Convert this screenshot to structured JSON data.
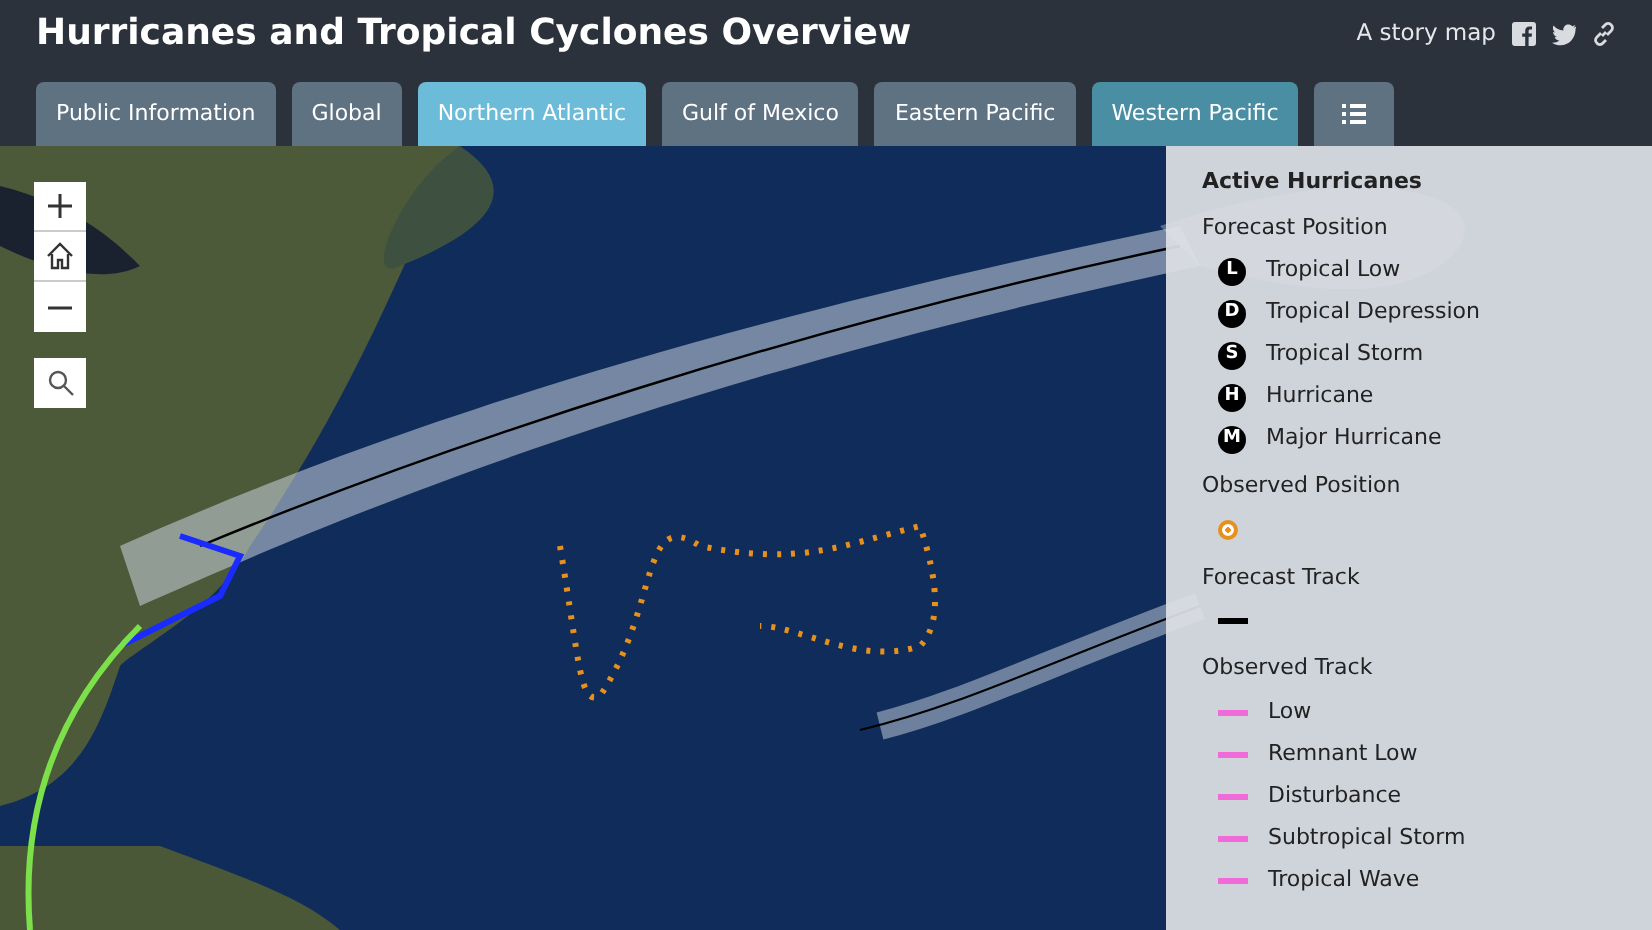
{
  "header": {
    "title": "Hurricanes and Tropical Cyclones Overview",
    "tagline": "A story map"
  },
  "tabs": [
    {
      "label": "Public Information",
      "selected": false,
      "hovered": false,
      "kind": "text"
    },
    {
      "label": "Global",
      "selected": false,
      "hovered": false,
      "kind": "text"
    },
    {
      "label": "Northern Atlantic",
      "selected": true,
      "hovered": false,
      "kind": "text"
    },
    {
      "label": "Gulf of Mexico",
      "selected": false,
      "hovered": false,
      "kind": "text"
    },
    {
      "label": "Eastern Pacific",
      "selected": false,
      "hovered": false,
      "kind": "text"
    },
    {
      "label": "Western Pacific",
      "selected": false,
      "hovered": true,
      "kind": "text"
    },
    {
      "selected": false,
      "hovered": false,
      "kind": "list"
    }
  ],
  "legend": {
    "title": "Active Hurricanes",
    "sections": [
      {
        "heading": "Forecast Position",
        "items": [
          {
            "kind": "symbol",
            "symbol": "L",
            "label": "Tropical Low"
          },
          {
            "kind": "symbol",
            "symbol": "D",
            "label": "Tropical Depression"
          },
          {
            "kind": "symbol",
            "symbol": "S",
            "label": "Tropical Storm"
          },
          {
            "kind": "symbol",
            "symbol": "H",
            "label": "Hurricane"
          },
          {
            "kind": "symbol",
            "symbol": "M",
            "label": "Major Hurricane"
          }
        ]
      },
      {
        "heading": "Observed Position",
        "items": [
          {
            "kind": "dot",
            "color": "#e8901c"
          }
        ]
      },
      {
        "heading": "Forecast Track",
        "items": [
          {
            "kind": "line",
            "color": "#000000"
          }
        ]
      },
      {
        "heading": "Observed Track",
        "items": [
          {
            "kind": "line",
            "color": "#f06ad8",
            "label": "Low"
          },
          {
            "kind": "line",
            "color": "#f06ad8",
            "label": "Remnant Low"
          },
          {
            "kind": "line",
            "color": "#f06ad8",
            "label": "Disturbance"
          },
          {
            "kind": "line",
            "color": "#f06ad8",
            "label": "Subtropical Storm"
          },
          {
            "kind": "line",
            "color": "#f06ad8",
            "label": "Tropical Wave"
          }
        ]
      }
    ]
  }
}
